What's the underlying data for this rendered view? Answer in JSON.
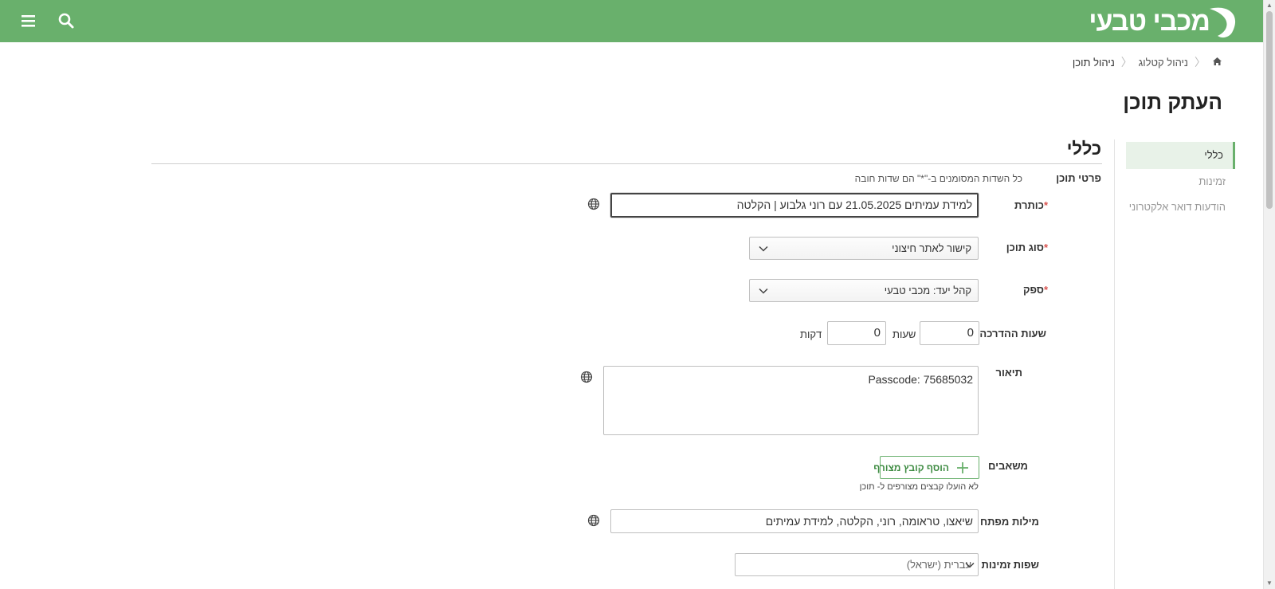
{
  "header": {
    "logo_text": "מכבי טבעי",
    "menu_icon": "hamburger-menu-icon",
    "search_icon": "search-icon",
    "brand_color": "#69b06c"
  },
  "breadcrumb": {
    "home_icon": "home-icon",
    "items": [
      "ניהול קטלוג",
      "ניהול תוכן"
    ]
  },
  "page_title": "העתק תוכן",
  "sidebar": {
    "items": [
      {
        "label": "כללי",
        "active": true
      },
      {
        "label": "זמינות",
        "active": false
      },
      {
        "label": "הודעות דואר אלקטרוני",
        "active": false
      }
    ]
  },
  "section": {
    "title": "כללי",
    "subtitle": "פרטי תוכן",
    "required_note": "כל השדות המסומנים ב-\"*\" הם שדות חובה"
  },
  "form": {
    "title": {
      "label": "כותרת",
      "required": "*",
      "value": "למידת עמיתים 21.05.2025 עם רוני גלבוע | הקלטה"
    },
    "content_type": {
      "label": "סוג תוכן",
      "required": "*",
      "value": "קישור לאתר חיצוני"
    },
    "provider": {
      "label": "ספק",
      "required": "*",
      "value": "קהל יעד: מכבי טבעי"
    },
    "training_hours": {
      "label": "שעות ההדרכה",
      "hours_value": "0",
      "hours_label": "שעות",
      "minutes_value": "0",
      "minutes_label": "דקות"
    },
    "description": {
      "label": "תיאור",
      "value": "Passcode: 75685032"
    },
    "resources": {
      "label": "משאבים",
      "add_button": "הוסף קובץ מצורף",
      "empty_note": "לא הועלו קבצים מצורפים ל- תוכן"
    },
    "keywords": {
      "label": "מילות מפתח",
      "value": "שיאצו, טראומה, רוני, הקלטה, למידת עמיתים"
    },
    "languages": {
      "label": "שפות זמינות",
      "value": "עברית (ישראל)"
    }
  }
}
